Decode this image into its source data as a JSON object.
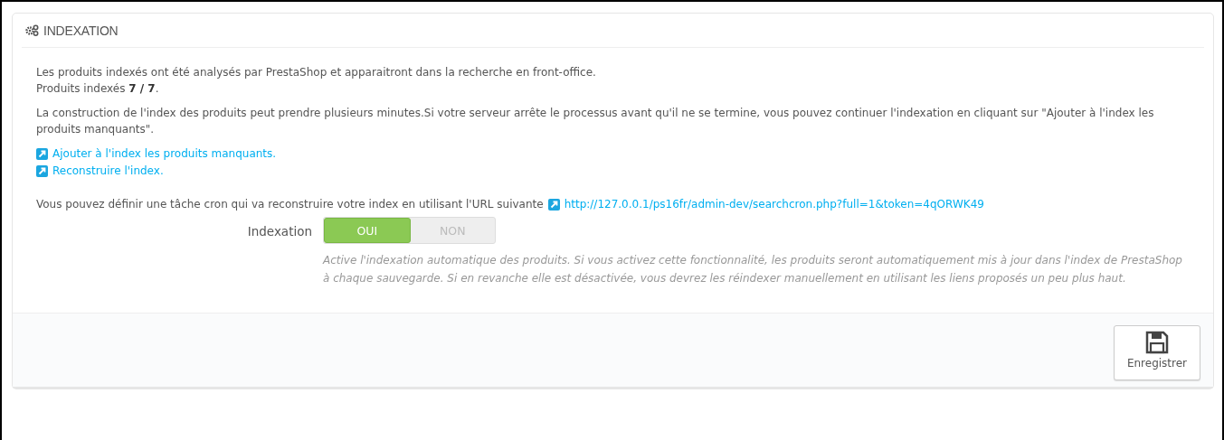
{
  "panel": {
    "title": "INDEXATION"
  },
  "intro": [
    "Les produits indexés ont été analysés par PrestaShop et apparaitront dans la recherche en front-office.",
    "Produits indexés **7 / 7**."
  ],
  "note": "La construction de l'index des produits peut prendre plusieurs minutes.Si votre serveur arrête le processus avant qu'il ne se termine, vous pouvez continuer l'indexation en cliquant sur \"Ajouter à l'index les produits manquants\".",
  "links": [
    "Ajouter à l'index les produits manquants.",
    "Reconstruire l'index."
  ],
  "cron": {
    "text": "Vous pouvez définir une tâche cron qui va reconstruire votre index en utilisant l'URL suivante",
    "url": "http://127.0.0.1/ps16fr/admin-dev/searchcron.php?full=1&token=4qORWK49"
  },
  "setting": {
    "label": "Indexation",
    "options": [
      {
        "label": "OUI",
        "selected": true
      },
      {
        "label": "NON",
        "selected": false
      }
    ],
    "help": "Active l'indexation automatique des produits. Si vous activez cette fonctionnalité, les produits seront automatiquement mis à jour dans l'index de PrestaShop à chaque sauvegarde. Si en revanche elle est désactivée, vous devrez les réindexer manuellement en utilisant les liens proposés un peu plus haut."
  },
  "save_button": "Enregistrer"
}
